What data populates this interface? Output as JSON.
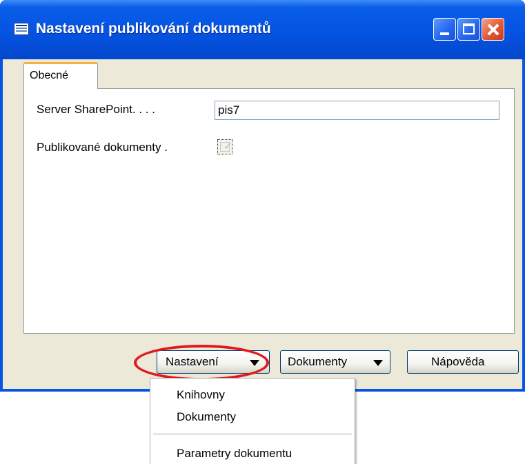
{
  "window": {
    "title": "Nastavení publikování dokumentů"
  },
  "tabs": [
    {
      "label": "Obecné",
      "active": true
    }
  ],
  "form": {
    "server_label": "Server SharePoint. . . .",
    "server_value": "pis7",
    "published_label": "Publikované dokumenty .",
    "published_checked": true
  },
  "buttons": {
    "nastaveni": "Nastavení",
    "dokumenty": "Dokumenty",
    "napoveda": "Nápověda"
  },
  "menu": {
    "items": [
      {
        "label": "Knihovny"
      },
      {
        "label": "Dokumenty"
      },
      {
        "label": "Parametry dokumentu"
      }
    ]
  },
  "colors": {
    "titlebar": "#0553e2",
    "highlight": "#e0191f",
    "client": "#ece9d8"
  }
}
